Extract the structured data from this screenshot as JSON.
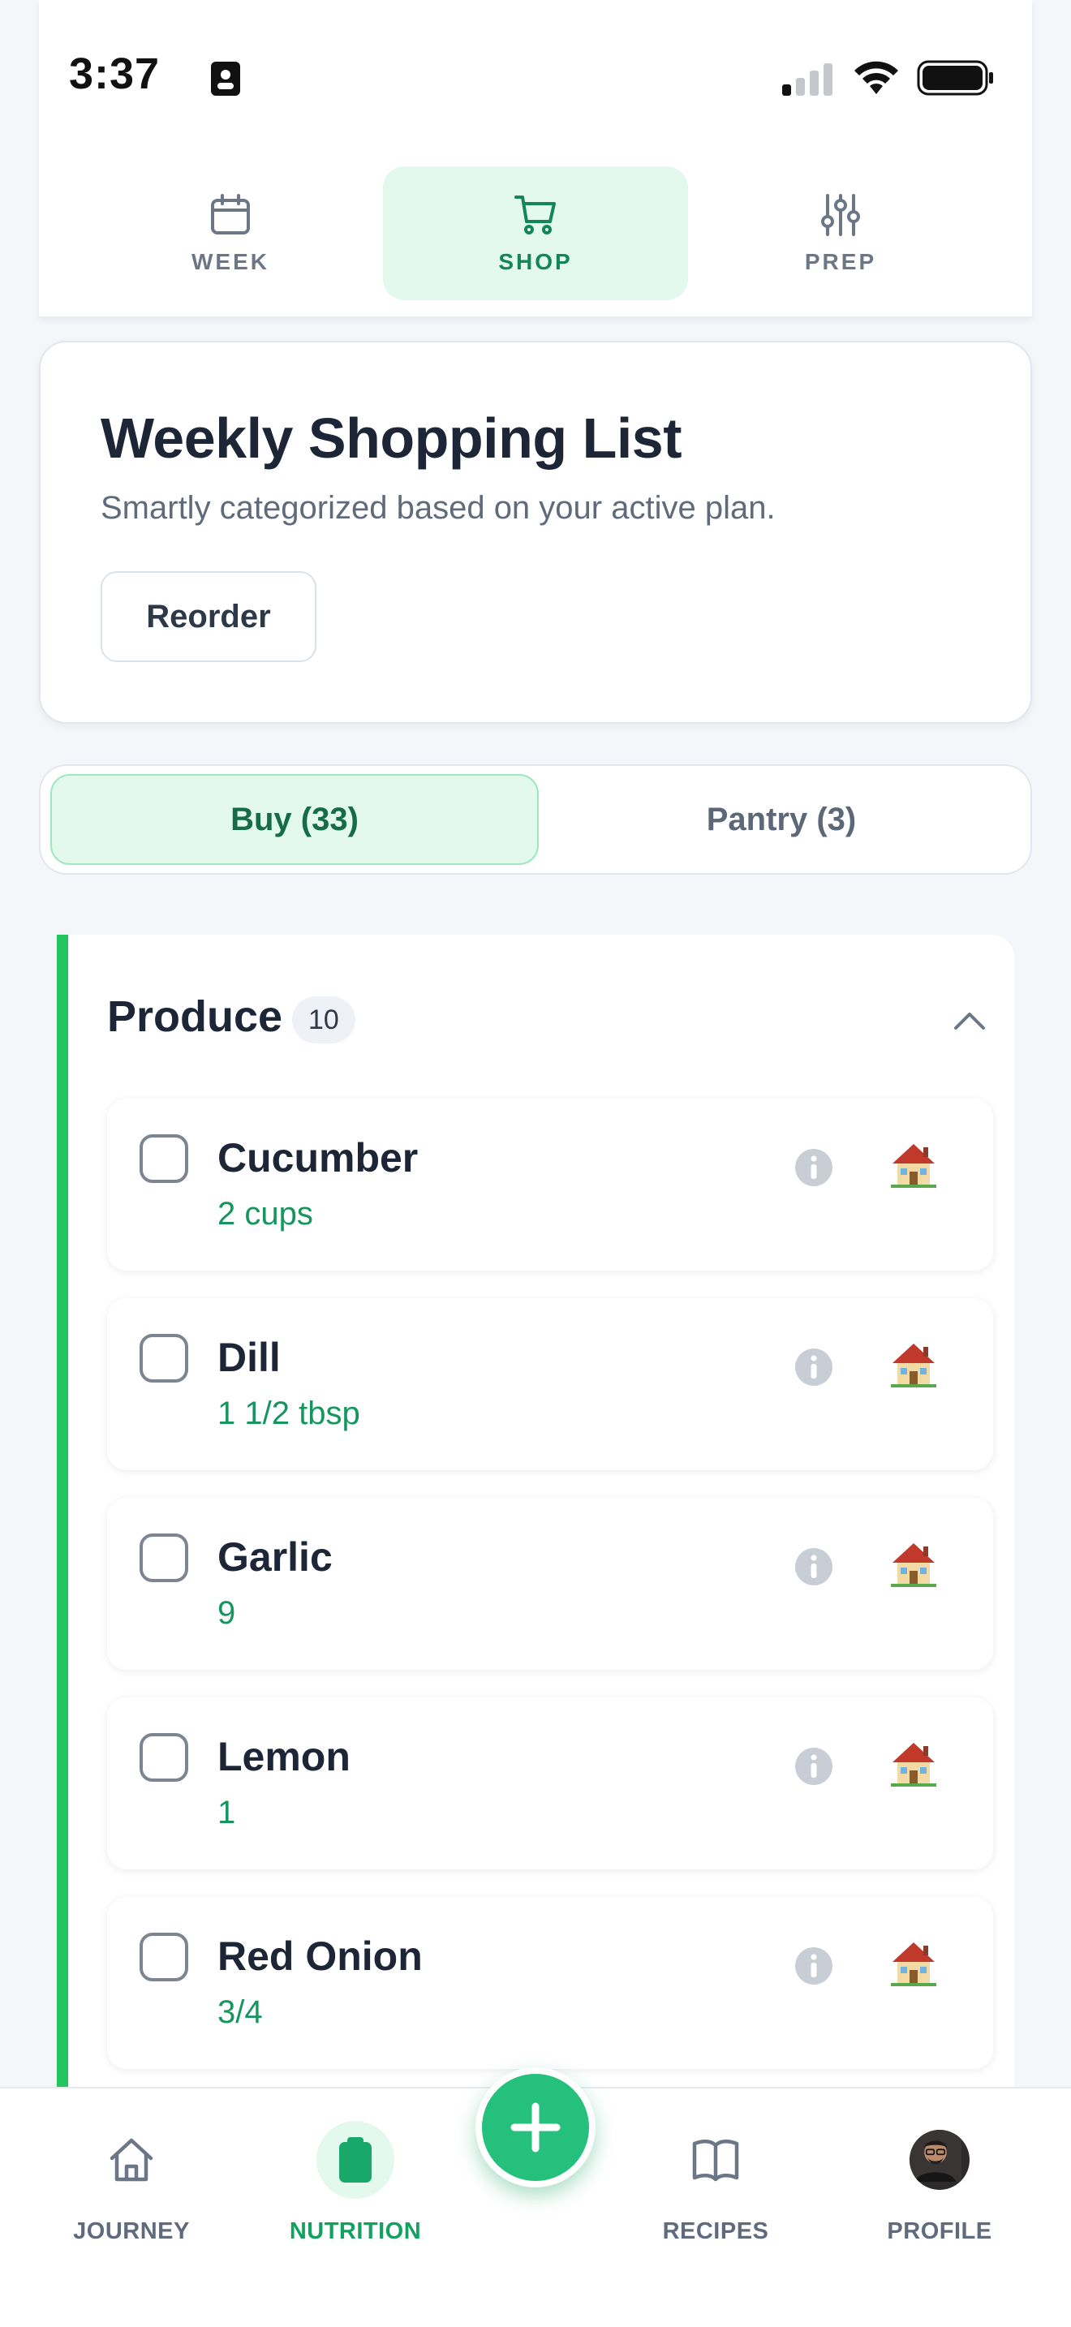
{
  "status_bar": {
    "time": "3:37"
  },
  "top_tabs": [
    {
      "label": "WEEK",
      "icon": "calendar-icon",
      "active": false
    },
    {
      "label": "SHOP",
      "icon": "cart-icon",
      "active": true
    },
    {
      "label": "PREP",
      "icon": "sliders-icon",
      "active": false
    }
  ],
  "header": {
    "title": "Weekly Shopping List",
    "subtitle": "Smartly categorized based on your active plan.",
    "reorder_label": "Reorder"
  },
  "segments": {
    "buy_label": "Buy (33)",
    "pantry_label": "Pantry (3)"
  },
  "section": {
    "title": "Produce",
    "count": "10",
    "items": [
      {
        "name": "Cucumber",
        "qty": "2 cups"
      },
      {
        "name": "Dill",
        "qty": "1 1/2 tbsp"
      },
      {
        "name": "Garlic",
        "qty": "9"
      },
      {
        "name": "Lemon",
        "qty": "1"
      },
      {
        "name": "Red Onion",
        "qty": "3/4"
      }
    ]
  },
  "bottom_nav": {
    "journey": "JOURNEY",
    "nutrition": "NUTRITION",
    "recipes": "RECIPES",
    "profile": "PROFILE"
  },
  "colors": {
    "accent": "#22c55e",
    "accent_text": "#14845a",
    "fab": "#24c07c"
  }
}
